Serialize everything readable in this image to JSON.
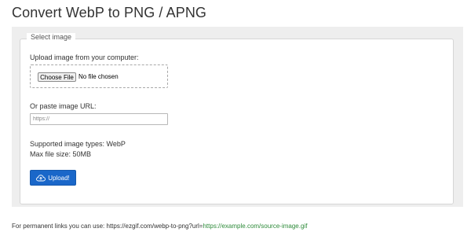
{
  "page": {
    "title": "Convert WebP to PNG / APNG"
  },
  "form": {
    "legend": "Select image",
    "upload_label": "Upload image from your computer:",
    "choose_file_label": "Choose File",
    "no_file_text": "No file chosen",
    "url_label": "Or paste image URL:",
    "url_placeholder": "https://",
    "url_value": "",
    "supported_types": "Supported image types: WebP",
    "max_size": "Max file size: 50MB",
    "upload_button_label": "Upload!",
    "upload_icon": "cloud-upload-icon"
  },
  "footer": {
    "prefix": "For permanent links you can use: https://ezgif.com/webp-to-png?url=",
    "link_text": "https://example.com/source-image.gif"
  },
  "colors": {
    "accent_button": "#1a67c9",
    "link_green": "#2e8b3a",
    "panel_gray": "#eeeeee"
  }
}
